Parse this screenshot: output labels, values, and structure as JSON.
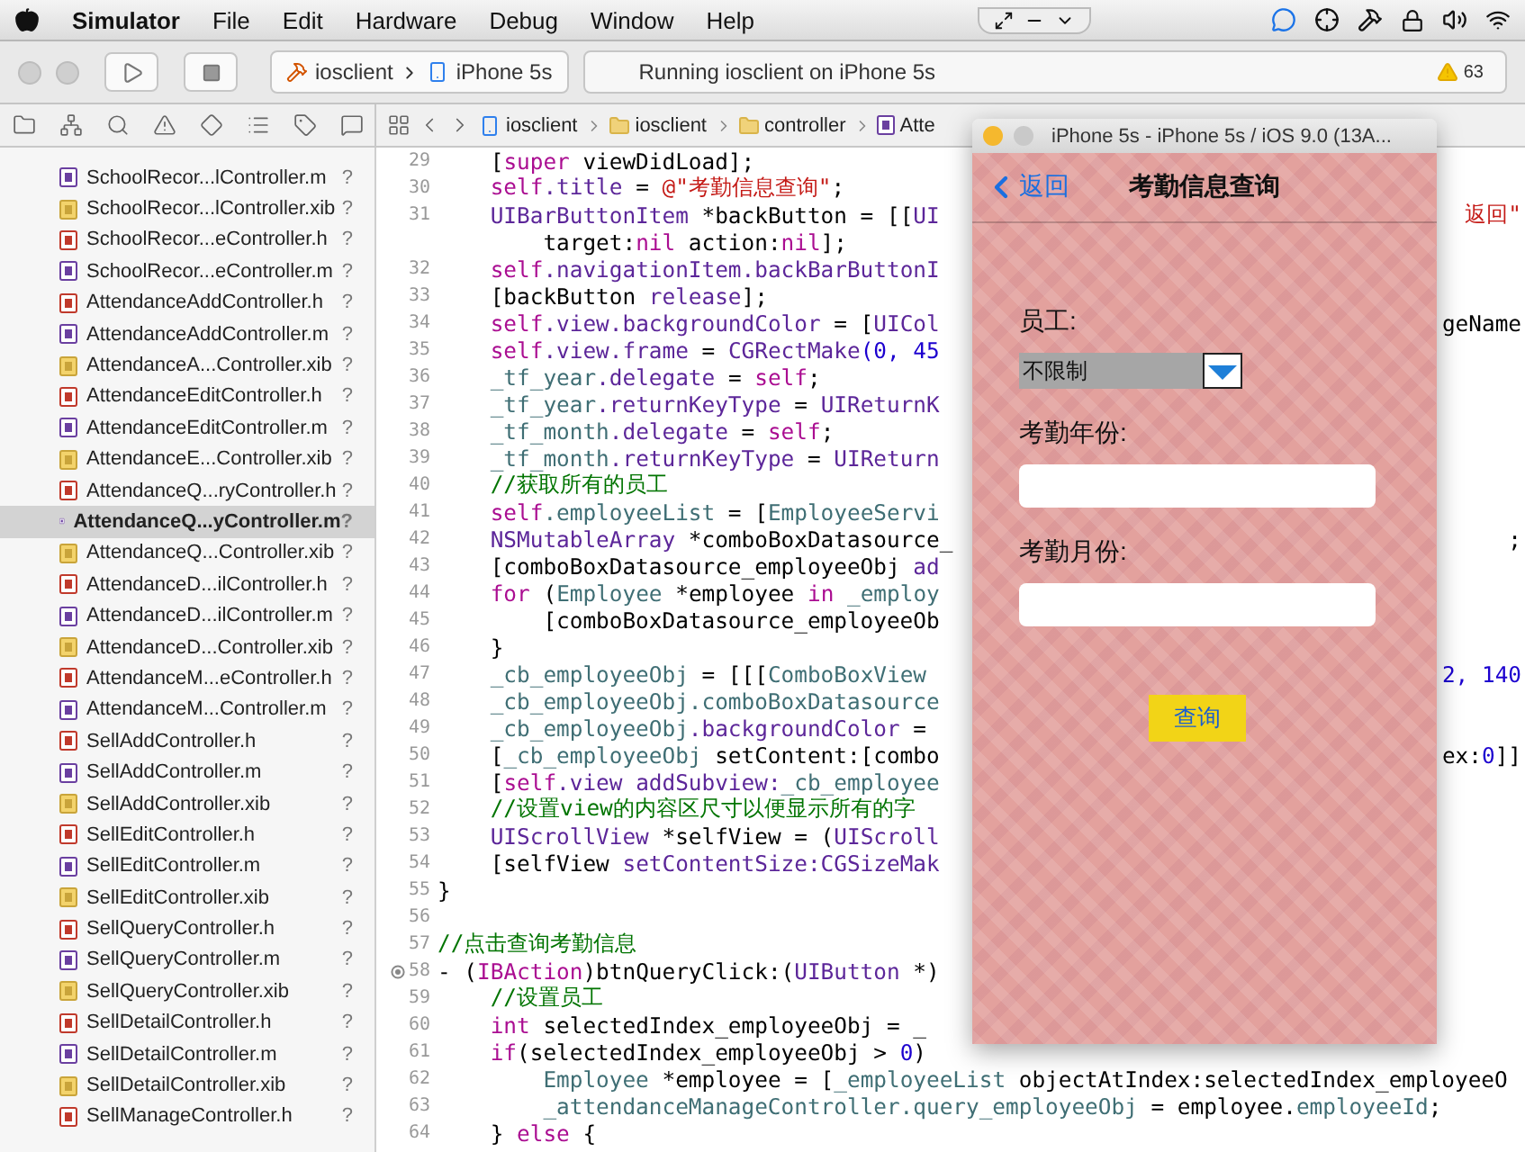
{
  "menu_bar": {
    "app": "Simulator",
    "items": [
      "File",
      "Edit",
      "Hardware",
      "Debug",
      "Window",
      "Help"
    ]
  },
  "toolbar": {
    "scheme": "iosclient",
    "device": "iPhone 5s",
    "status": "Running iosclient on iPhone 5s",
    "warnings": "63"
  },
  "jump_bar": {
    "path": [
      {
        "label": "iosclient",
        "kind": "project"
      },
      {
        "label": "iosclient",
        "kind": "folder"
      },
      {
        "label": "controller",
        "kind": "folder"
      },
      {
        "label": "Atte",
        "kind": "impl"
      }
    ]
  },
  "navigator": {
    "files": [
      {
        "name": "SchoolRecor...lController.m",
        "kind": "impl",
        "status": "?",
        "selected": false
      },
      {
        "name": "SchoolRecor...lController.xib",
        "kind": "xib",
        "status": "?",
        "selected": false
      },
      {
        "name": "SchoolRecor...eController.h",
        "kind": "header",
        "status": "?",
        "selected": false
      },
      {
        "name": "SchoolRecor...eController.m",
        "kind": "impl",
        "status": "?",
        "selected": false
      },
      {
        "name": "AttendanceAddController.h",
        "kind": "header",
        "status": "?",
        "selected": false
      },
      {
        "name": "AttendanceAddController.m",
        "kind": "impl",
        "status": "?",
        "selected": false
      },
      {
        "name": "AttendanceA...Controller.xib",
        "kind": "xib",
        "status": "?",
        "selected": false
      },
      {
        "name": "AttendanceEditController.h",
        "kind": "header",
        "status": "?",
        "selected": false
      },
      {
        "name": "AttendanceEditController.m",
        "kind": "impl",
        "status": "?",
        "selected": false
      },
      {
        "name": "AttendanceE...Controller.xib",
        "kind": "xib",
        "status": "?",
        "selected": false
      },
      {
        "name": "AttendanceQ...ryController.h",
        "kind": "header",
        "status": "?",
        "selected": false
      },
      {
        "name": "AttendanceQ...yController.m",
        "kind": "impl",
        "status": "?",
        "selected": true
      },
      {
        "name": "AttendanceQ...Controller.xib",
        "kind": "xib",
        "status": "?",
        "selected": false
      },
      {
        "name": "AttendanceD...ilController.h",
        "kind": "header",
        "status": "?",
        "selected": false
      },
      {
        "name": "AttendanceD...ilController.m",
        "kind": "impl",
        "status": "?",
        "selected": false
      },
      {
        "name": "AttendanceD...Controller.xib",
        "kind": "xib",
        "status": "?",
        "selected": false
      },
      {
        "name": "AttendanceM...eController.h",
        "kind": "header",
        "status": "?",
        "selected": false
      },
      {
        "name": "AttendanceM...Controller.m",
        "kind": "impl",
        "status": "?",
        "selected": false
      },
      {
        "name": "SellAddController.h",
        "kind": "header",
        "status": "?",
        "selected": false
      },
      {
        "name": "SellAddController.m",
        "kind": "impl",
        "status": "?",
        "selected": false
      },
      {
        "name": "SellAddController.xib",
        "kind": "xib",
        "status": "?",
        "selected": false
      },
      {
        "name": "SellEditController.h",
        "kind": "header",
        "status": "?",
        "selected": false
      },
      {
        "name": "SellEditController.m",
        "kind": "impl",
        "status": "?",
        "selected": false
      },
      {
        "name": "SellEditController.xib",
        "kind": "xib",
        "status": "?",
        "selected": false
      },
      {
        "name": "SellQueryController.h",
        "kind": "header",
        "status": "?",
        "selected": false
      },
      {
        "name": "SellQueryController.m",
        "kind": "impl",
        "status": "?",
        "selected": false
      },
      {
        "name": "SellQueryController.xib",
        "kind": "xib",
        "status": "?",
        "selected": false
      },
      {
        "name": "SellDetailController.h",
        "kind": "header",
        "status": "?",
        "selected": false
      },
      {
        "name": "SellDetailController.m",
        "kind": "impl",
        "status": "?",
        "selected": false
      },
      {
        "name": "SellDetailController.xib",
        "kind": "xib",
        "status": "?",
        "selected": false
      },
      {
        "name": "SellManageController.h",
        "kind": "header",
        "status": "?",
        "selected": false
      }
    ]
  },
  "editor": {
    "lines": [
      {
        "number": "29",
        "breakpoint": false,
        "parts": [
          {
            "text": "    [",
            "kind": "p"
          },
          {
            "text": "super",
            "kind": "k"
          },
          {
            "text": " viewDidLoad];",
            "kind": "p"
          }
        ]
      },
      {
        "number": "30",
        "breakpoint": false,
        "parts": [
          {
            "text": "    self",
            "kind": "k"
          },
          {
            "text": ".title",
            "kind": "t"
          },
          {
            "text": " = ",
            "kind": "p"
          },
          {
            "text": "@\"考勤信息查询\"",
            "kind": "s"
          },
          {
            "text": ";",
            "kind": "p"
          }
        ]
      },
      {
        "number": "31",
        "breakpoint": false,
        "parts": [
          {
            "text": "    UIBarButtonItem",
            "kind": "t"
          },
          {
            "text": " *backButton = [[",
            "kind": "p"
          },
          {
            "text": "UI",
            "kind": "t"
          }
        ],
        "tail": [
          {
            "text": "返回\"",
            "kind": "s"
          }
        ]
      },
      {
        "breakpoint": false,
        "parts": [
          {
            "text": "        target:",
            "kind": "p"
          },
          {
            "text": "nil",
            "kind": "k"
          },
          {
            "text": " action:",
            "kind": "p"
          },
          {
            "text": "nil",
            "kind": "k"
          },
          {
            "text": "];",
            "kind": "p"
          }
        ]
      },
      {
        "number": "32",
        "breakpoint": false,
        "parts": [
          {
            "text": "    self",
            "kind": "k"
          },
          {
            "text": ".navigationItem.backBarButtonI",
            "kind": "t"
          }
        ]
      },
      {
        "number": "33",
        "breakpoint": false,
        "parts": [
          {
            "text": "    [backButton ",
            "kind": "p"
          },
          {
            "text": "release",
            "kind": "t"
          },
          {
            "text": "];",
            "kind": "p"
          }
        ]
      },
      {
        "number": "34",
        "breakpoint": false,
        "parts": [
          {
            "text": "    self",
            "kind": "k"
          },
          {
            "text": ".view.backgroundColor",
            "kind": "t"
          },
          {
            "text": " = [",
            "kind": "p"
          },
          {
            "text": "UICol",
            "kind": "t"
          }
        ],
        "tail": [
          {
            "text": "geName",
            "kind": "p"
          }
        ]
      },
      {
        "number": "35",
        "breakpoint": false,
        "parts": [
          {
            "text": "    self",
            "kind": "k"
          },
          {
            "text": ".view.frame",
            "kind": "t"
          },
          {
            "text": " = ",
            "kind": "p"
          },
          {
            "text": "CGRectMake",
            "kind": "t"
          },
          {
            "text": "(0, 45",
            "kind": "n"
          }
        ]
      },
      {
        "number": "36",
        "breakpoint": false,
        "parts": [
          {
            "text": "    _tf_year",
            "kind": "m"
          },
          {
            "text": ".delegate",
            "kind": "t"
          },
          {
            "text": " = ",
            "kind": "p"
          },
          {
            "text": "self",
            "kind": "k"
          },
          {
            "text": ";",
            "kind": "p"
          }
        ]
      },
      {
        "number": "37",
        "breakpoint": false,
        "parts": [
          {
            "text": "    _tf_year",
            "kind": "m"
          },
          {
            "text": ".returnKeyType",
            "kind": "t"
          },
          {
            "text": " = ",
            "kind": "p"
          },
          {
            "text": "UIReturnK",
            "kind": "t"
          }
        ]
      },
      {
        "number": "38",
        "breakpoint": false,
        "parts": [
          {
            "text": "    _tf_month",
            "kind": "m"
          },
          {
            "text": ".delegate",
            "kind": "t"
          },
          {
            "text": " = ",
            "kind": "p"
          },
          {
            "text": "self",
            "kind": "k"
          },
          {
            "text": ";",
            "kind": "p"
          }
        ]
      },
      {
        "number": "39",
        "breakpoint": false,
        "parts": [
          {
            "text": "    _tf_month",
            "kind": "m"
          },
          {
            "text": ".returnKeyType",
            "kind": "t"
          },
          {
            "text": " = ",
            "kind": "p"
          },
          {
            "text": "UIReturn",
            "kind": "t"
          }
        ]
      },
      {
        "number": "40",
        "breakpoint": false,
        "parts": [
          {
            "text": "    //获取所有的员工",
            "kind": "c"
          }
        ]
      },
      {
        "number": "41",
        "breakpoint": false,
        "parts": [
          {
            "text": "    self",
            "kind": "k"
          },
          {
            "text": ".employeeList",
            "kind": "m"
          },
          {
            "text": " = [",
            "kind": "p"
          },
          {
            "text": "EmployeeServi",
            "kind": "m"
          }
        ]
      },
      {
        "number": "42",
        "breakpoint": false,
        "parts": [
          {
            "text": "    NSMutableArray",
            "kind": "t"
          },
          {
            "text": " *comboBoxDatasource_",
            "kind": "p"
          }
        ],
        "tail": [
          {
            "text": ";",
            "kind": "p"
          }
        ]
      },
      {
        "number": "43",
        "breakpoint": false,
        "parts": [
          {
            "text": "    [comboBoxDatasource_employeeObj ",
            "kind": "p"
          },
          {
            "text": "ad",
            "kind": "t"
          }
        ]
      },
      {
        "number": "44",
        "breakpoint": false,
        "parts": [
          {
            "text": "    for",
            "kind": "k"
          },
          {
            "text": " (",
            "kind": "p"
          },
          {
            "text": "Employee",
            "kind": "m"
          },
          {
            "text": " *employee ",
            "kind": "p"
          },
          {
            "text": "in",
            "kind": "k"
          },
          {
            "text": " _employ",
            "kind": "m"
          }
        ]
      },
      {
        "number": "45",
        "breakpoint": false,
        "parts": [
          {
            "text": "        [comboBoxDatasource_employeeOb",
            "kind": "p"
          }
        ]
      },
      {
        "number": "46",
        "breakpoint": false,
        "parts": [
          {
            "text": "    }",
            "kind": "p"
          }
        ]
      },
      {
        "number": "47",
        "breakpoint": false,
        "parts": [
          {
            "text": "    _cb_employeeObj",
            "kind": "m"
          },
          {
            "text": " = [[[",
            "kind": "p"
          },
          {
            "text": "ComboBoxView",
            "kind": "m"
          }
        ],
        "tail": [
          {
            "text": "2, 140",
            "kind": "n"
          }
        ]
      },
      {
        "number": "48",
        "breakpoint": false,
        "parts": [
          {
            "text": "    _cb_employeeObj.comboBoxDatasource",
            "kind": "m"
          }
        ]
      },
      {
        "number": "49",
        "breakpoint": false,
        "parts": [
          {
            "text": "    _cb_employeeObj",
            "kind": "m"
          },
          {
            "text": ".backgroundColor",
            "kind": "t"
          },
          {
            "text": " =",
            "kind": "p"
          }
        ]
      },
      {
        "number": "50",
        "breakpoint": false,
        "parts": [
          {
            "text": "    [",
            "kind": "p"
          },
          {
            "text": "_cb_employeeObj",
            "kind": "m"
          },
          {
            "text": " setContent:[combo",
            "kind": "p"
          }
        ],
        "tail": [
          {
            "text": "ex:",
            "kind": "p"
          },
          {
            "text": "0",
            "kind": "n"
          },
          {
            "text": "]]",
            "kind": "p"
          }
        ]
      },
      {
        "number": "51",
        "breakpoint": false,
        "parts": [
          {
            "text": "    [",
            "kind": "p"
          },
          {
            "text": "self",
            "kind": "k"
          },
          {
            "text": ".view addSubview:",
            "kind": "t"
          },
          {
            "text": "_cb_employee",
            "kind": "m"
          }
        ]
      },
      {
        "number": "52",
        "breakpoint": false,
        "parts": [
          {
            "text": "    //设置view的内容区尺寸以便显示所有的字",
            "kind": "c"
          }
        ]
      },
      {
        "number": "53",
        "breakpoint": false,
        "parts": [
          {
            "text": "    UIScrollView",
            "kind": "t"
          },
          {
            "text": " *selfView = (",
            "kind": "p"
          },
          {
            "text": "UIScroll",
            "kind": "t"
          }
        ]
      },
      {
        "number": "54",
        "breakpoint": false,
        "parts": [
          {
            "text": "    [selfView ",
            "kind": "p"
          },
          {
            "text": "setContentSize:CGSizeMak",
            "kind": "t"
          }
        ]
      },
      {
        "number": "55",
        "breakpoint": false,
        "parts": [
          {
            "text": "}",
            "kind": "p"
          }
        ]
      },
      {
        "number": "56",
        "breakpoint": false
      },
      {
        "number": "57",
        "breakpoint": false,
        "parts": [
          {
            "text": "//点击查询考勤信息",
            "kind": "c"
          }
        ]
      },
      {
        "number": "58",
        "breakpoint": true,
        "parts": [
          {
            "text": "- (",
            "kind": "p"
          },
          {
            "text": "IBAction",
            "kind": "k"
          },
          {
            "text": ")btnQueryClick:(",
            "kind": "p"
          },
          {
            "text": "UIButton",
            "kind": "t"
          },
          {
            "text": " *)",
            "kind": "p"
          }
        ]
      },
      {
        "number": "59",
        "breakpoint": false,
        "parts": [
          {
            "text": "    //设置员工",
            "kind": "c"
          }
        ]
      },
      {
        "number": "60",
        "breakpoint": false,
        "parts": [
          {
            "text": "    int",
            "kind": "k"
          },
          {
            "text": " selectedIndex_employeeObj = _",
            "kind": "p"
          }
        ]
      },
      {
        "number": "61",
        "breakpoint": false,
        "parts": [
          {
            "text": "    if",
            "kind": "k"
          },
          {
            "text": "(selectedIndex_employeeObj > ",
            "kind": "p"
          },
          {
            "text": "0",
            "kind": "n"
          },
          {
            "text": ")",
            "kind": "p"
          }
        ]
      },
      {
        "number": "62",
        "breakpoint": false,
        "parts": [
          {
            "text": "        Employee",
            "kind": "m"
          },
          {
            "text": " *employee = [",
            "kind": "p"
          },
          {
            "text": "_employeeList",
            "kind": "m"
          },
          {
            "text": " objectAtIndex:selectedIndex_employeeO",
            "kind": "p"
          }
        ]
      },
      {
        "number": "63",
        "breakpoint": false,
        "parts": [
          {
            "text": "        _attendanceManageController.query_employeeObj",
            "kind": "m"
          },
          {
            "text": " = employee.",
            "kind": "p"
          },
          {
            "text": "employeeId",
            "kind": "m"
          },
          {
            "text": ";",
            "kind": "p"
          }
        ]
      },
      {
        "number": "64",
        "breakpoint": false,
        "parts": [
          {
            "text": "    } ",
            "kind": "p"
          },
          {
            "text": "else",
            "kind": "k"
          },
          {
            "text": " {",
            "kind": "p"
          }
        ]
      }
    ]
  },
  "simulator": {
    "title": "iPhone 5s - iPhone 5s / iOS 9.0 (13A...",
    "back": "返回",
    "nav_title": "考勤信息查询",
    "fields": [
      {
        "kind": "combo",
        "label": "员工:",
        "value": "不限制"
      },
      {
        "kind": "text",
        "label": "考勤年份:"
      },
      {
        "kind": "text",
        "label": "考勤月份:"
      }
    ],
    "button": "查询"
  }
}
